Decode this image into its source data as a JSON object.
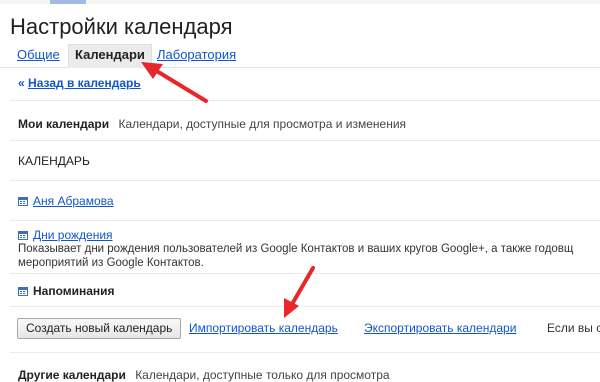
{
  "page": {
    "title": "Настройки календаря"
  },
  "tabs": [
    {
      "label": "Общие",
      "active": false
    },
    {
      "label": "Календари",
      "active": true
    },
    {
      "label": "Лаборатория",
      "active": false
    }
  ],
  "back_link": {
    "prefix": "«",
    "label": "Назад в календарь"
  },
  "my_calendars": {
    "heading": "Мои календари",
    "description": "Календари, доступные для просмотра и изменения",
    "column_header": "КАЛЕНДАРЬ",
    "items": [
      {
        "name": "Аня Абрамова",
        "icon": "calendar-icon",
        "linked": true
      },
      {
        "name": "Дни рождения",
        "icon": "calendar-icon",
        "linked": true,
        "description_line1": "Показывает дни рождения пользователей из Google Контактов и ваших кругов Google+, а также годовщ",
        "description_line2": "мероприятий из Google Контактов."
      },
      {
        "name": "Напоминания",
        "icon": "calendar-icon",
        "linked": false
      }
    ]
  },
  "actions": {
    "create_button": "Создать новый календарь",
    "import_link": "Импортировать календарь",
    "export_link": "Экспортировать календари",
    "trailing_text": "Если вы с"
  },
  "other_calendars": {
    "heading": "Другие календари",
    "description": "Календари, доступные только для просмотра"
  },
  "colors": {
    "link": "#1155cc",
    "annotation_arrow": "#e8262b",
    "active_tab_bg": "#ebebeb"
  }
}
